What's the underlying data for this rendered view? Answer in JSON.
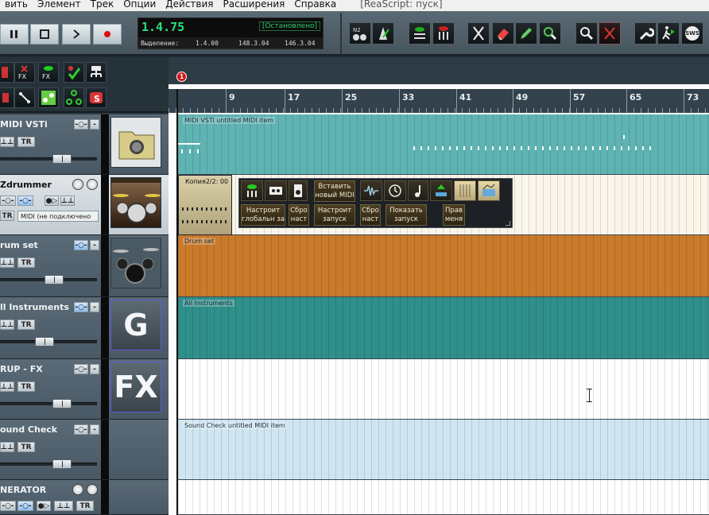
{
  "menu": {
    "items": [
      "вить",
      "Элемент",
      "Трек",
      "Опции",
      "Действия",
      "Расширения",
      "Справка"
    ],
    "title": "[ReaScript: пуск]"
  },
  "transport": {
    "position": "1.4.75",
    "state": "[Остановлено]",
    "selection_label": "Выделение:",
    "selection_start": "1.4.00",
    "selection_end": "148.3.04",
    "selection_length": "146.3.04"
  },
  "ruler": {
    "marker_number": "1",
    "bars": [
      "9",
      "17",
      "25",
      "33",
      "41",
      "49",
      "57",
      "65",
      "73"
    ]
  },
  "tracks": [
    {
      "name": "MIDI VSTi",
      "buttons": [
        "⊥⊥",
        "TR"
      ]
    },
    {
      "name": "Zdrummer",
      "buttons": [
        "⊥⊥",
        "TR"
      ],
      "status": "MIDI (не подключено"
    },
    {
      "name": "rum set",
      "buttons": [
        "⊥⊥",
        "TR"
      ]
    },
    {
      "name": "ll Instruments",
      "buttons": [
        "⊥⊥",
        "TR"
      ],
      "thumb_letter": "G"
    },
    {
      "name": "RUP - FX",
      "buttons": [
        "⊥⊥",
        "TR"
      ],
      "thumb_letter": "FX"
    },
    {
      "name": "ound Check",
      "buttons": [
        "⊥⊥",
        "TR"
      ]
    },
    {
      "name": "NERATOR",
      "buttons": [
        "⊥⊥",
        "TR"
      ]
    }
  ],
  "items": {
    "midi_vsti": "MIDI VSTi untitled MIDI item",
    "zdrummer": "Копия2/2: 00",
    "drum_set": "Drum set",
    "all_instruments": "All Instruments",
    "sound_check": "Sound Check untitled MIDI item"
  },
  "floating_toolbar": {
    "labels": [
      "Вставить новый MIDI",
      "Настроит глобальн за",
      "Сбро наст",
      "Настроит запуск экш",
      "Сбро наст",
      "Показать запуск экш",
      "Прав меня"
    ]
  },
  "toolbar_icons": {
    "sws": "SWS"
  },
  "colors": {
    "midi_lane": "#5fb3b3",
    "drum_lane": "#c97a2a",
    "instr_lane": "#2f8f8a",
    "sound_lane": "#cfe6f2"
  }
}
